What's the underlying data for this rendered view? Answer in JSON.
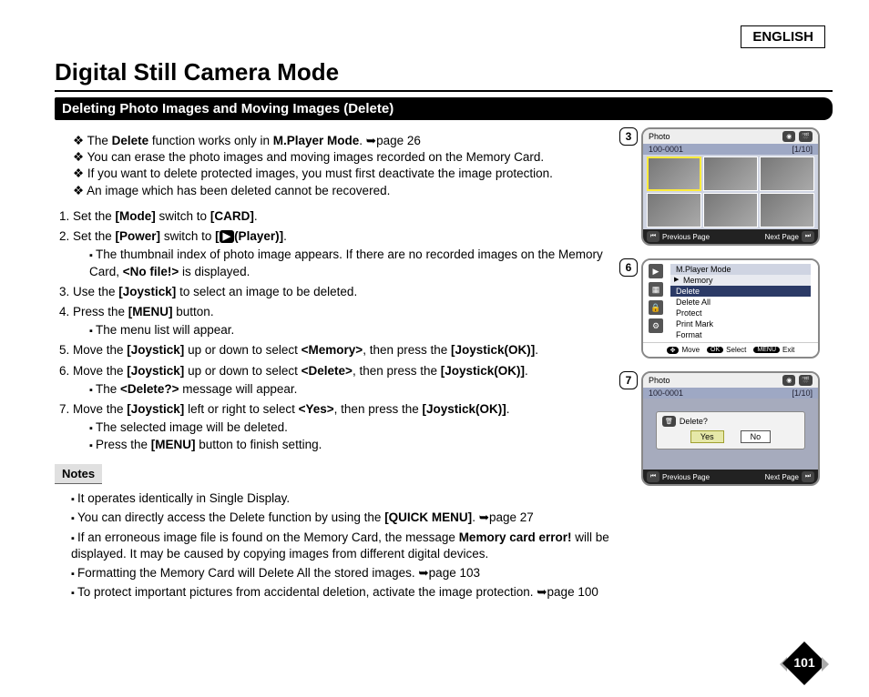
{
  "header": {
    "language": "ENGLISH",
    "title": "Digital Still Camera Mode",
    "section": "Deleting Photo Images and Moving Images (Delete)"
  },
  "intro": [
    {
      "pre": "The ",
      "b1": "Delete",
      "mid": " function works only in ",
      "b2": "M.Player Mode",
      "post": ". ➥page 26"
    },
    {
      "text": "You can erase the photo images and moving images recorded on the Memory Card."
    },
    {
      "text": "If you want to delete protected images, you must first deactivate the image protection."
    },
    {
      "text": "An image which has been deleted cannot be recovered."
    }
  ],
  "steps": {
    "s1": {
      "pre": "Set the ",
      "b1": "[Mode]",
      "mid": " switch to ",
      "b2": "[CARD]",
      "post": "."
    },
    "s2": {
      "pre": "Set the ",
      "b1": "[Power]",
      "mid": " switch to ",
      "b2_open": "[",
      "chip": "▶",
      "b2_label": "(Player)]",
      "post": "."
    },
    "s2sub": {
      "a_pre": "The thumbnail index of photo image appears. If there are no recorded images on the Memory Card, ",
      "a_b": "<No file!>",
      "a_post": " is displayed."
    },
    "s3": {
      "pre": "Use the ",
      "b1": "[Joystick]",
      "post": " to select an image to be deleted."
    },
    "s4": {
      "pre": "Press the ",
      "b1": "[MENU]",
      "post": " button."
    },
    "s4sub": {
      "a": "The menu list will appear."
    },
    "s5": {
      "pre": "Move the ",
      "b1": "[Joystick]",
      "mid": " up or down to select ",
      "b2": "<Memory>",
      "mid2": ", then press the ",
      "b3": "[Joystick(OK)]",
      "post": "."
    },
    "s6": {
      "pre": "Move the ",
      "b1": "[Joystick]",
      "mid": " up or down to select ",
      "b2": "<Delete>",
      "mid2": ", then press the ",
      "b3": "[Joystick(OK)]",
      "post": "."
    },
    "s6sub": {
      "a_pre": "The ",
      "a_b": "<Delete?>",
      "a_post": " message will appear."
    },
    "s7": {
      "pre": "Move the ",
      "b1": "[Joystick]",
      "mid": " left or right to select ",
      "b2": "<Yes>",
      "mid2": ", then press the ",
      "b3": "[Joystick(OK)]",
      "post": "."
    },
    "s7sub": {
      "a": "The selected image will be deleted.",
      "b_pre": "Press the ",
      "b_b": "[MENU]",
      "b_post": " button to finish setting."
    }
  },
  "notes": {
    "label": "Notes",
    "items": {
      "n1": "It operates identically in Single Display.",
      "n2_pre": "You can directly access the Delete function by using the ",
      "n2_b": "[QUICK MENU]",
      "n2_post": ". ➥page 27",
      "n3_pre": "If an erroneous image file is found on the Memory Card, the message ",
      "n3_b": "Memory card error!",
      "n3_post": " will be displayed. It may be caused by copying images from different digital devices.",
      "n4": "Formatting the Memory Card will Delete All the stored images. ➥page 103",
      "n5": "To protect important pictures from accidental deletion, activate the image protection. ➥page 100"
    }
  },
  "screens": {
    "s3": {
      "badge": "3",
      "mode": "Photo",
      "file": "100-0001",
      "counter": "[1/10]",
      "prev": "Previous Page",
      "next": "Next Page"
    },
    "s6": {
      "badge": "6",
      "mode": "M.Player Mode",
      "sub": "Memory",
      "items": [
        "Delete",
        "Delete All",
        "Protect",
        "Print Mark",
        "Format"
      ],
      "move": "Move",
      "select": "Select",
      "exit": "Exit",
      "ok": "OK",
      "menu": "MENU"
    },
    "s7": {
      "badge": "7",
      "mode": "Photo",
      "file": "100-0001",
      "counter": "[1/10]",
      "dialog": "Delete?",
      "yes": "Yes",
      "no": "No",
      "prev": "Previous Page",
      "next": "Next Page"
    }
  },
  "page_number": "101"
}
